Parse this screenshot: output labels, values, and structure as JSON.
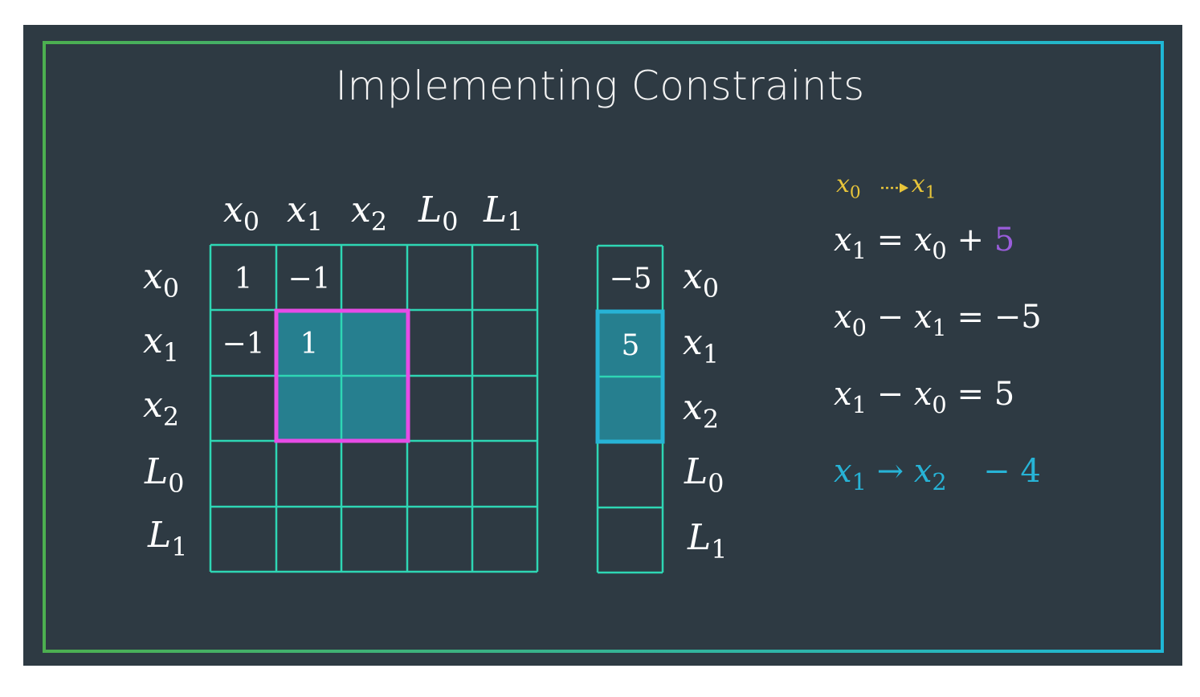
{
  "title": "Implementing  Constraints",
  "matrix": {
    "col_labels": [
      {
        "v": "x",
        "s": "0"
      },
      {
        "v": "L",
        "s": "0"
      }
    ],
    "cols": [
      {
        "v": "x",
        "s": "0"
      },
      {
        "v": "x",
        "s": "1"
      },
      {
        "v": "x",
        "s": "2"
      },
      {
        "v": "L",
        "s": "0"
      },
      {
        "v": "L",
        "s": "1"
      }
    ],
    "rows": [
      {
        "v": "x",
        "s": "0"
      },
      {
        "v": "x",
        "s": "1"
      },
      {
        "v": "x",
        "s": "2"
      },
      {
        "v": "L",
        "s": "0"
      },
      {
        "v": "L",
        "s": "1"
      }
    ],
    "cells": {
      "r0c0": "1",
      "r0c1": "−1",
      "r1c0": "−1",
      "r1c1": "1"
    }
  },
  "vector": {
    "rows": [
      {
        "v": "x",
        "s": "0"
      },
      {
        "v": "x",
        "s": "1"
      },
      {
        "v": "x",
        "s": "2"
      },
      {
        "v": "L",
        "s": "0"
      },
      {
        "v": "L",
        "s": "1"
      }
    ],
    "cells": {
      "r0": "−5",
      "r1": "5"
    }
  },
  "equations": {
    "motion_from": {
      "v": "x",
      "s": "0"
    },
    "motion_to": {
      "v": "x",
      "s": "1"
    },
    "eq1": {
      "lhs_v": "x",
      "lhs_s": "1",
      "eq": "=",
      "rhs_v": "x",
      "rhs_s": "0",
      "op": "+",
      "val": "5"
    },
    "eq2": {
      "a_v": "x",
      "a_s": "0",
      "op": "−",
      "b_v": "x",
      "b_s": "1",
      "eq": "=",
      "val": "−5"
    },
    "eq3": {
      "a_v": "x",
      "a_s": "1",
      "op": "−",
      "b_v": "x",
      "b_s": "0",
      "eq": "=",
      "val": "5"
    },
    "eq4": {
      "a_v": "x",
      "a_s": "1",
      "arrow": "→",
      "b_v": "x",
      "b_s": "2",
      "val": "− 4"
    }
  },
  "colors": {
    "background": "#2e3a43",
    "grid": "#2ed6b4",
    "highlight_fill": "#267f8f",
    "highlight_matrix_border": "#e64ce6",
    "highlight_vector_border": "#27b3d6",
    "yellow": "#e8c53a",
    "purple": "#9a5ddb",
    "cyan": "#27b3d6"
  }
}
